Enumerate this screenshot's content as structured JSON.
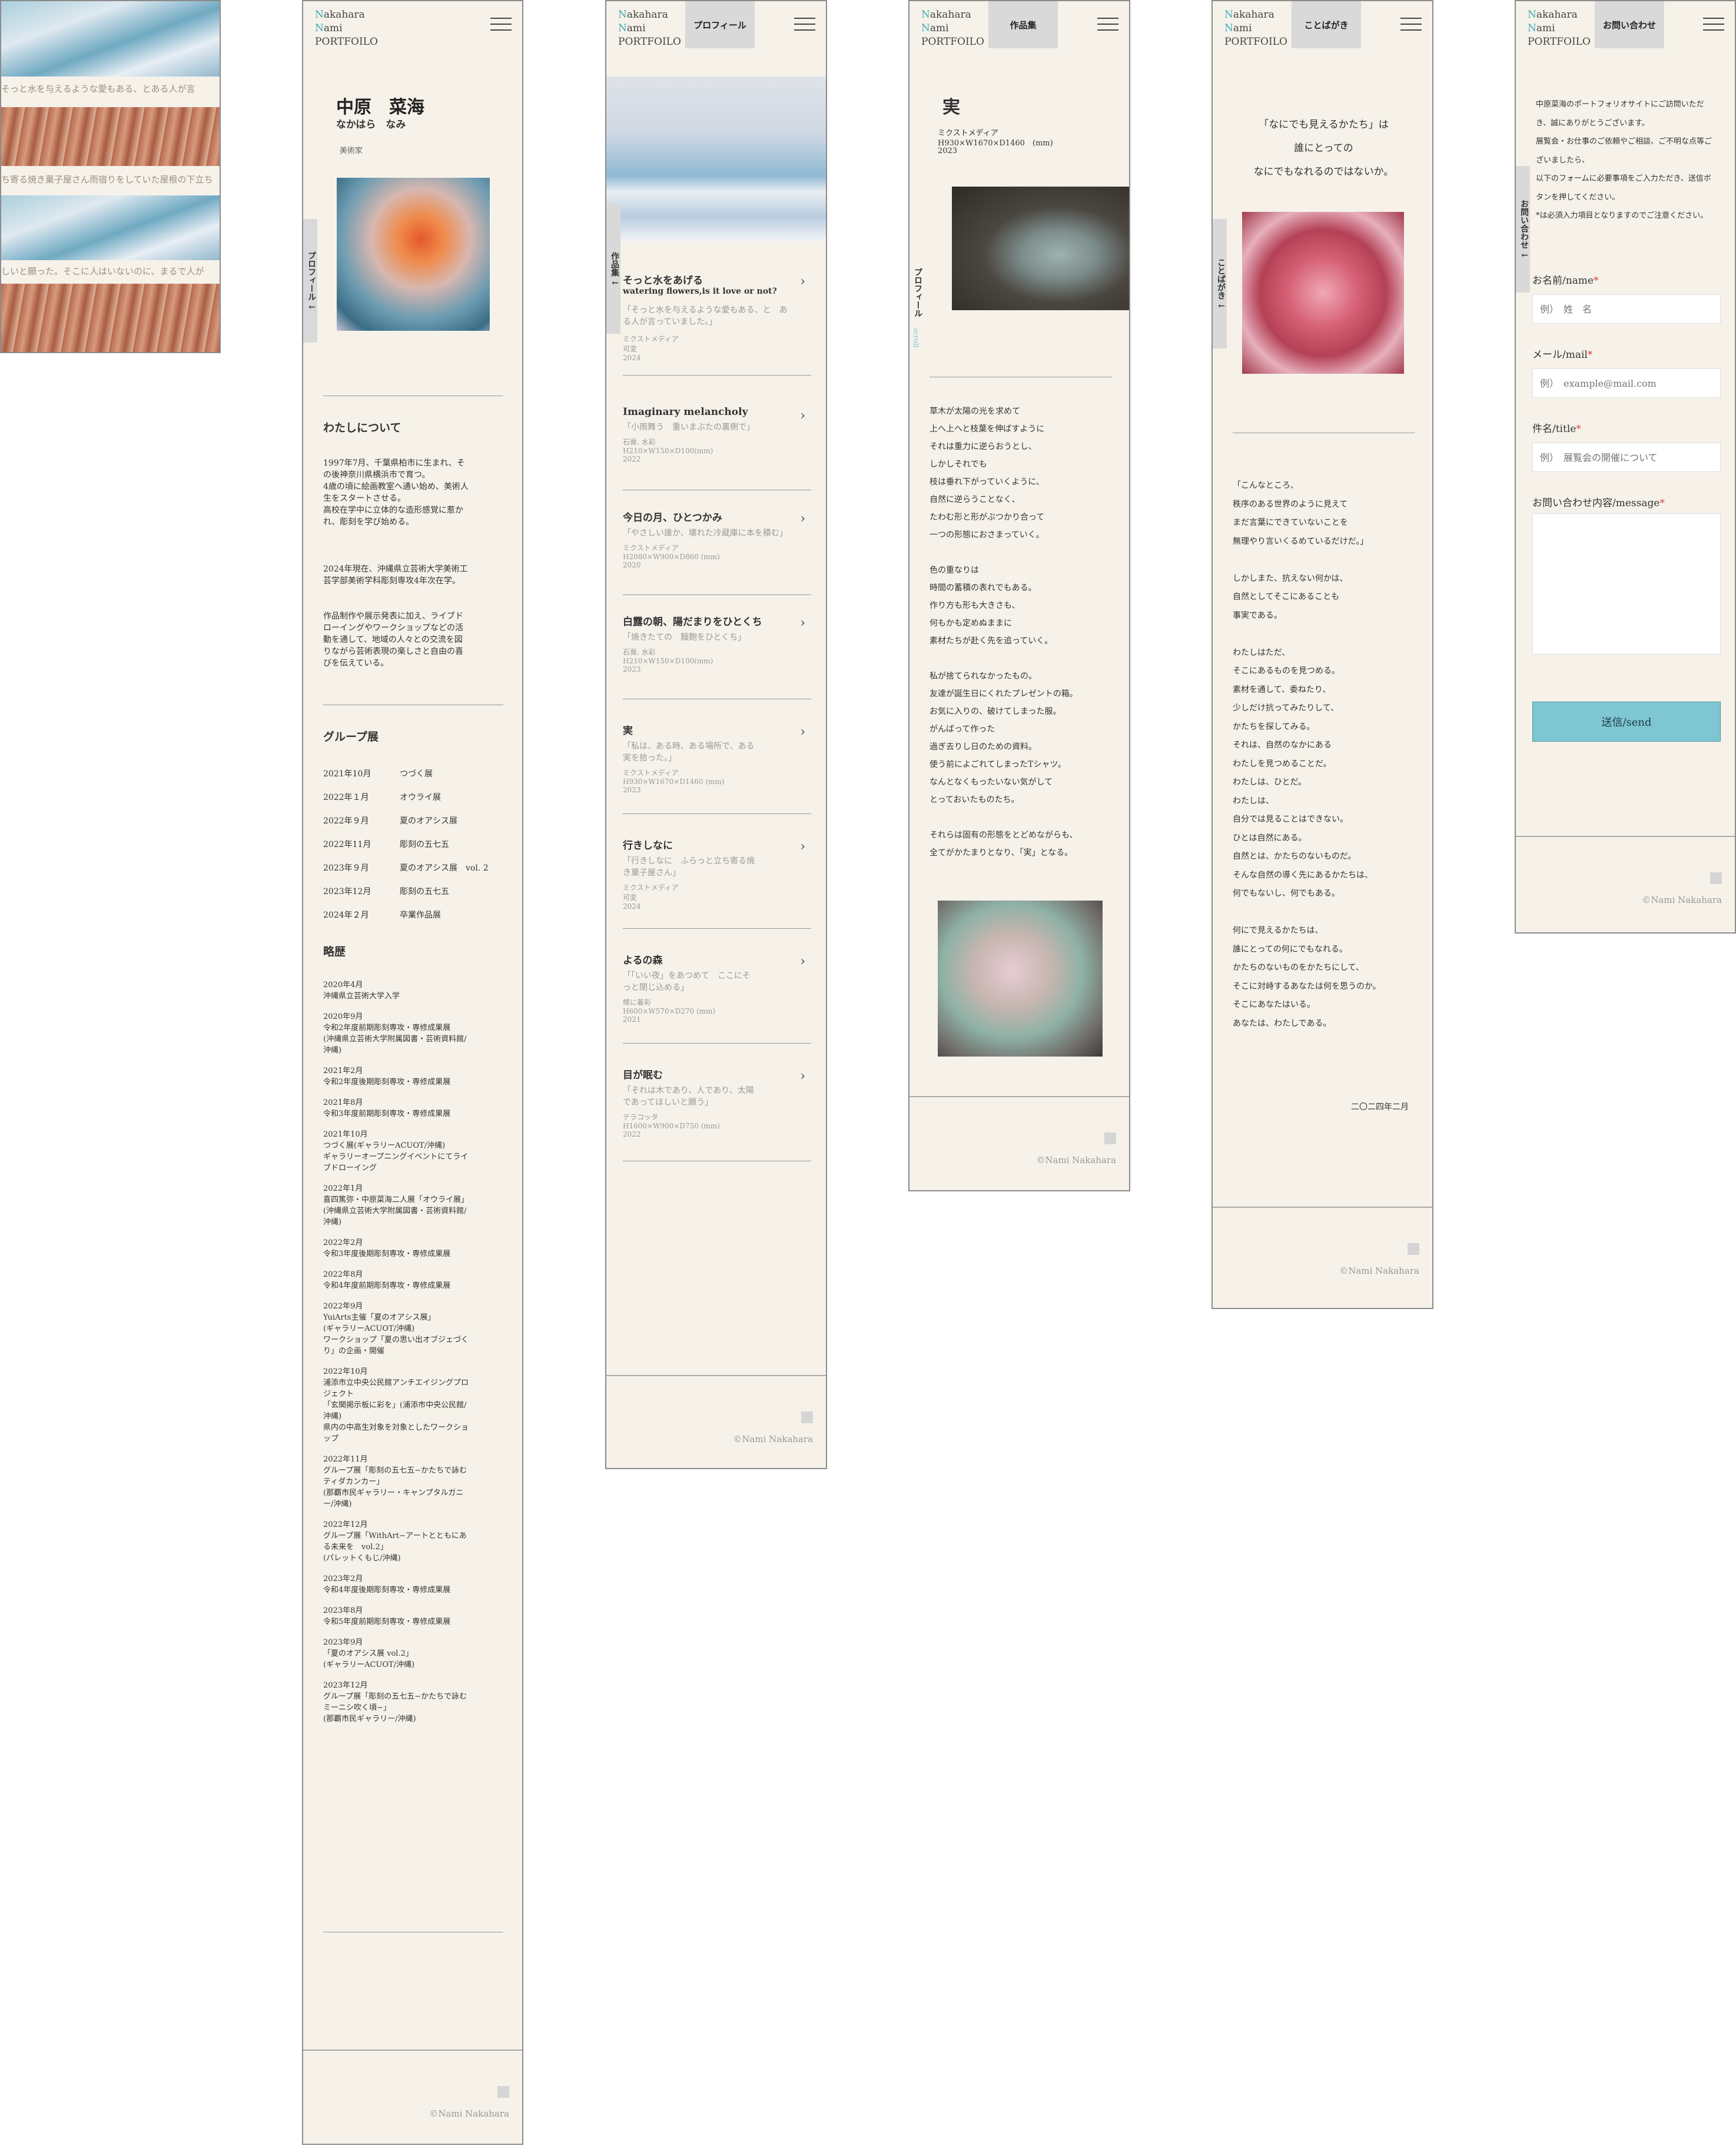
{
  "slideshow": {
    "captions": [
      "そっと水を与えるような愛もある、とある人が言",
      "ち寄る焼き菓子屋さん雨宿りをしていた屋根の下立ち",
      "しいと願った。そこに人はいないのに、まるで人が"
    ]
  },
  "common": {
    "logo_line1_initial": "N",
    "logo_line1_rest": "akahara",
    "logo_line2_initial": "N",
    "logo_line2_rest": "ami",
    "logo_line3": "PORTFOILO",
    "copyright": "©Nami Nakahara"
  },
  "profile": {
    "name": "中原　菜海",
    "reading": "なかはら　なみ",
    "role": "美術家",
    "side_tab": "プロフィール",
    "about_heading": "わたしについて",
    "about_paragraphs": [
      "1997年7月、千葉県柏市に生まれ、その後神奈川県横浜市で育つ。\n4歳の頃に絵画教室へ通い始め、美術人生をスタートさせる。\n高校在学中に立体的な造形感覚に惹かれ、彫刻を学び始める。",
      "2024年現在、沖縄県立芸術大学美術工芸学部美術学科彫刻専攻4年次在学。",
      "作品制作や展示発表に加え、ライブドローイングやワークショップなどの活動を通して、地域の人々との交流を図りながら芸術表現の楽しさと自由の喜びを伝えている。"
    ],
    "group_heading": "グループ展",
    "group_shows": [
      {
        "date": "2021年10月",
        "title": "つづく展"
      },
      {
        "date": "2022年１月",
        "title": "オウライ展"
      },
      {
        "date": "2022年９月",
        "title": "夏のオアシス展"
      },
      {
        "date": "2022年11月",
        "title": "彫刻の五七五"
      },
      {
        "date": "2023年９月",
        "title": "夏のオアシス展　vol. 2"
      },
      {
        "date": "2023年12月",
        "title": "彫刻の五七五"
      },
      {
        "date": "2024年２月",
        "title": "卒業作品展"
      }
    ],
    "history_heading": "略歴",
    "history": [
      "2020年4月\n沖縄県立芸術大学入学",
      "2020年9月\n令和2年度前期彫刻専攻・専修成果展\n(沖縄県立芸術大学附属図書・芸術資料館/沖縄)",
      "2021年2月\n令和2年度後期彫刻専攻・専修成果展",
      "2021年8月\n令和3年度前期彫刻専攻・専修成果展",
      "2021年10月\nつづく展(ギャラリーACUOT/沖縄)\nギャラリーオープニングイベントにてライブドローイング",
      "2022年1月\n喜四篤弥・中原菜海二人展「オウライ展」\n(沖縄県立芸術大学附属図書・芸術資料館/沖縄)",
      "2022年2月\n令和3年度後期彫刻専攻・専修成果展",
      "2022年8月\n令和4年度前期彫刻専攻・専修成果展",
      "2022年9月\nYuiArts主催「夏のオアシス展」\n(ギャラリーACUOT/沖縄)\nワークショップ「夏の思い出オブジェづくり」の企画・開催",
      "2022年10月\n浦添市立中央公民館アンチエイジングプロジェクト\n「玄関掲示板に彩を」(浦添市中央公民館/沖縄)\n県内の中高生対象を対象としたワークショップ",
      "2022年11月\nグループ展「彫刻の五七五−かたちで詠むティダカンカー」\n(那覇市民ギャラリー・キャンプタルガニー/沖縄)",
      "2022年12月\nグループ展「WithArt−アートとともにある未来を　vol.2」\n(パレットくもじ/沖縄)",
      "2023年2月\n令和4年度後期彫刻専攻・専修成果展",
      "2023年8月\n令和5年度前期彫刻専攻・専修成果展",
      "2023年9月\n「夏のオアシス展 vol.2」\n(ギャラリーACUOT/沖縄)",
      "2023年12月\nグループ展「彫刻の五七五−かたちで詠むミーニシ吹く頃−」\n(那覇市民ギャラリー/沖縄)"
    ]
  },
  "works": {
    "tab": "プロフィール",
    "side_tab": "作品集",
    "items": [
      {
        "title": "そっと水をあげる",
        "subtitle": "watering flowers,is it love or not?",
        "quote": "「そっと水を与えるような愛もある、と　ある人が言っていました。」",
        "material": "ミクストメディア",
        "size": "可変",
        "year": "2024"
      },
      {
        "title": "Imaginary melancholy",
        "subtitle": "",
        "quote": "「小雨舞う　重いまぶたの裏側で」",
        "material": "石膏, 水彩",
        "size": "H210×W150×D100(mm)",
        "year": "2022"
      },
      {
        "title": "今日の月、ひとつかみ",
        "subtitle": "",
        "quote": "「やさしい誰か、壊れた冷蔵庫に本を積む」",
        "material": "ミクストメディア",
        "size": "H2080×W900×D860 (mm)",
        "year": "2020"
      },
      {
        "title": "白露の朝、陽だまりをひとくち",
        "subtitle": "",
        "quote": "「焼きたての　麺麭をひとくち」",
        "material": "石膏, 水彩",
        "size": "H210×W150×D100(mm)",
        "year": "2023"
      },
      {
        "title": "実",
        "subtitle": "",
        "quote": "「私は、ある時、ある場所で、ある実を拾った。」",
        "material": "ミクストメディア",
        "size": "H930×W1670×D1460 (mm)",
        "year": "2023"
      },
      {
        "title": "行きしなに",
        "subtitle": "",
        "quote": "「行きしなに　ふらっと立ち寄る焼き菓子屋さん」",
        "material": "ミクストメディア",
        "size": "可変",
        "year": "2024"
      },
      {
        "title": "よるの森",
        "subtitle": "",
        "quote": "「「いい夜」をあつめて　ここにそっと閉じ込める」",
        "material": "樟に着彩",
        "size": "H600×W570×D270 (mm)",
        "year": "2021"
      },
      {
        "title": "目が眠む",
        "subtitle": "",
        "quote": "「それは木であり、人であり、太陽であってほしいと願う」",
        "material": "テラコッタ",
        "size": "H1600×W900×D750 (mm)",
        "year": "2022"
      }
    ]
  },
  "detail": {
    "tab": "作品集",
    "side_tab": "プロフィール",
    "side_scroll": "scroll",
    "title": "実",
    "material": "ミクストメディア",
    "size": "H930×W1670×D1460　(mm)",
    "year": "2023",
    "poem": "草木が太陽の光を求めて\n上へ上へと枝葉を伸ばすように\nそれは重力に逆らおうとし、\nしかしそれでも\n枝は垂れ下がっていくように、\n自然に逆らうことなく、\nたわむ形と形がぶつかり合って\n一つの形態におさまっていく。\n\n色の重なりは\n時間の蓄積の表れでもある。\n作り方も形も大きさも、\n何もかも定めぬままに\n素材たちが赴く先を追っていく。\n\n私が捨てられなかったもの。\n友達が誕生日にくれたプレゼントの箱。\nお気に入りの、破けてしまった服。\nがんばって作った\n過ぎ去りし日のための資料。\n使う前によごれてしまったTシャツ。\nなんとなくもったいない気がして\nとっておいたものたち。\n\nそれらは固有の形態をとどめながらも、\n全てがかたまりとなり、「実」となる。"
  },
  "kotoba": {
    "tab": "ことばがき",
    "side_tab": "ことばがき",
    "lead": "「なにでも見えるかたち」は\n誰にとっての\nなにでもなれるのではないか。",
    "body": "「こんなところ、\n秩序のある世界のように見えて\nまだ言葉にできていないことを\n無理やり言いくるめているだけだ。」\n\nしかしまた、抗えない何かは、\n自然としてそこにあることも\n事実である。\n\nわたしはただ、\nそこにあるものを見つめる。\n素材を通して、委ねたり、\n少しだけ抗ってみたりして、\nかたちを探してみる。\nそれは、自然のなかにある\nわたしを見つめることだ。\nわたしは、ひとだ。\nわたしは、\n自分では見ることはできない。\nひとは自然にある。\n自然とは、かたちのないものだ。\nそんな自然の導く先にあるかたちは、\n何でもないし、何でもある。\n\n何にで見えるかたちは、\n誰にとっての何にでもなれる。\nかたちのないものをかたちにして、\nそこに対峙するあなたは何を思うのか。\nそこにあなたはいる。\nあなたは、わたしである。",
    "date": "二〇二四年二月"
  },
  "contact": {
    "tab": "お問い合わせ",
    "side_tab": "お問い合わせ",
    "intro": "中原菜海のポートフォリオサイトにご訪問いただき、誠にありがとうございます。\n展覧会・お仕事のご依頼やご相談、ご不明な点等ございましたら、\n以下のフォームに必要事項をご入力ただき、送信ボタンを押してください。\n*は必須入力項目となりますのでご注意ください。",
    "name_label": "お名前/name",
    "name_placeholder": "例）　姓　名",
    "mail_label": "メール/mail",
    "mail_placeholder": "例）　example@mail.com",
    "subject_label": "件名/title",
    "subject_placeholder": "例）　展覧会の開催について",
    "message_label": "お問い合わせ内容/message",
    "required_mark": "*",
    "send": "送信/send"
  },
  "colors": {
    "bg": "#f6f2ea",
    "accent": "#7fc6d3",
    "teal": "#3fa9b6",
    "required": "#e04040"
  }
}
